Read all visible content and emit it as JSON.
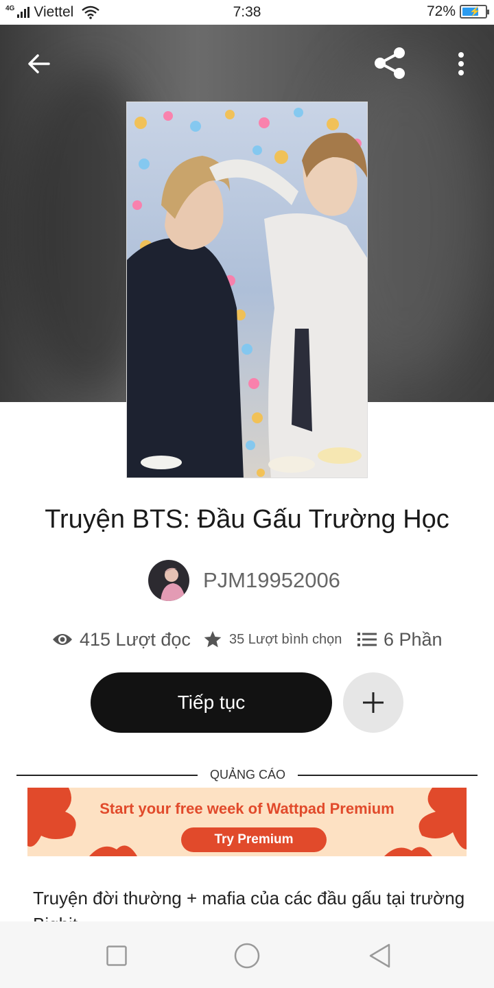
{
  "status_bar": {
    "network": "4G",
    "carrier": "Viettel",
    "time": "7:38",
    "battery": "72%",
    "battery_level": 0.72
  },
  "header": {
    "back_icon": "arrow-left-icon",
    "share_icon": "share-icon",
    "more_icon": "more-vertical-icon"
  },
  "story": {
    "title": "Truyện BTS: Đầu Gấu Trường Học",
    "author": "PJM19952006",
    "stats": {
      "reads": "415 Lượt đọc",
      "votes": "35 Lượt bình chọn",
      "parts": "6 Phần"
    },
    "continue_label": "Tiếp tục",
    "description": "Truyện đời thường + mafia của các đầu gấu tại trường Bighit"
  },
  "ad": {
    "label": "QUẢNG CÁO",
    "headline": "Start your free week of Wattpad Premium",
    "cta": "Try Premium"
  },
  "colors": {
    "primary_button": "#121212",
    "ad_accent": "#e14a2b",
    "ad_background": "#fde1c3"
  }
}
